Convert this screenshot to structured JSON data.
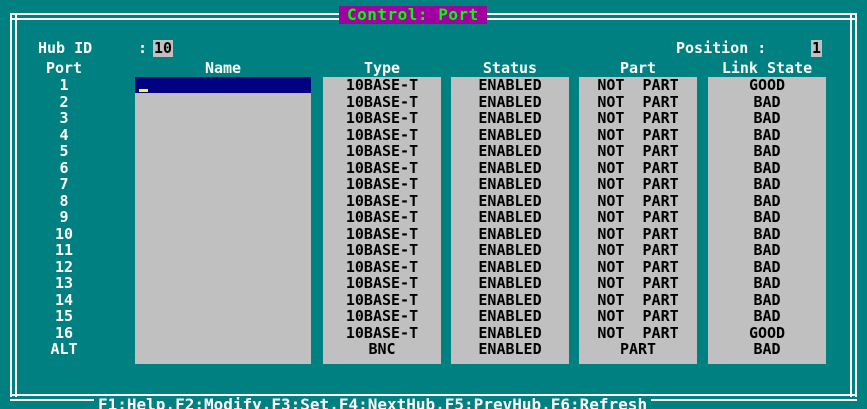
{
  "window": {
    "title": "Control: Port"
  },
  "hub": {
    "label": "Hub ID",
    "sep": ":",
    "id": "10"
  },
  "position": {
    "label": "Position :",
    "value": "1"
  },
  "headers": {
    "port": "Port",
    "name": "Name",
    "type": "Type",
    "status": "Status",
    "part": "Part",
    "link_state": "Link State"
  },
  "rows": [
    {
      "port": "1",
      "name": "",
      "type": "10BASE-T",
      "status": "ENABLED",
      "part": "NOT  PART",
      "link": "GOOD"
    },
    {
      "port": "2",
      "name": "",
      "type": "10BASE-T",
      "status": "ENABLED",
      "part": "NOT  PART",
      "link": "BAD"
    },
    {
      "port": "3",
      "name": "",
      "type": "10BASE-T",
      "status": "ENABLED",
      "part": "NOT  PART",
      "link": "BAD"
    },
    {
      "port": "4",
      "name": "",
      "type": "10BASE-T",
      "status": "ENABLED",
      "part": "NOT  PART",
      "link": "BAD"
    },
    {
      "port": "5",
      "name": "",
      "type": "10BASE-T",
      "status": "ENABLED",
      "part": "NOT  PART",
      "link": "BAD"
    },
    {
      "port": "6",
      "name": "",
      "type": "10BASE-T",
      "status": "ENABLED",
      "part": "NOT  PART",
      "link": "BAD"
    },
    {
      "port": "7",
      "name": "",
      "type": "10BASE-T",
      "status": "ENABLED",
      "part": "NOT  PART",
      "link": "BAD"
    },
    {
      "port": "8",
      "name": "",
      "type": "10BASE-T",
      "status": "ENABLED",
      "part": "NOT  PART",
      "link": "BAD"
    },
    {
      "port": "9",
      "name": "",
      "type": "10BASE-T",
      "status": "ENABLED",
      "part": "NOT  PART",
      "link": "BAD"
    },
    {
      "port": "10",
      "name": "",
      "type": "10BASE-T",
      "status": "ENABLED",
      "part": "NOT  PART",
      "link": "BAD"
    },
    {
      "port": "11",
      "name": "",
      "type": "10BASE-T",
      "status": "ENABLED",
      "part": "NOT  PART",
      "link": "BAD"
    },
    {
      "port": "12",
      "name": "",
      "type": "10BASE-T",
      "status": "ENABLED",
      "part": "NOT  PART",
      "link": "BAD"
    },
    {
      "port": "13",
      "name": "",
      "type": "10BASE-T",
      "status": "ENABLED",
      "part": "NOT  PART",
      "link": "BAD"
    },
    {
      "port": "14",
      "name": "",
      "type": "10BASE-T",
      "status": "ENABLED",
      "part": "NOT  PART",
      "link": "BAD"
    },
    {
      "port": "15",
      "name": "",
      "type": "10BASE-T",
      "status": "ENABLED",
      "part": "NOT  PART",
      "link": "BAD"
    },
    {
      "port": "16",
      "name": "",
      "type": "10BASE-T",
      "status": "ENABLED",
      "part": "NOT  PART",
      "link": "GOOD"
    },
    {
      "port": "ALT",
      "name": "",
      "type": "BNC",
      "status": "ENABLED",
      "part": "PART",
      "link": "BAD"
    }
  ],
  "footer": {
    "keys": "F1:Help,F2:Modify,F3:Set,F4:NextHub,F5:PrevHub,F6:Refresh"
  },
  "colors": {
    "background": "#008080",
    "title_bg": "#a000a0",
    "title_fg": "#00ff00",
    "field_bg": "#c0c0c0",
    "selection": "#000080",
    "cursor": "#ffff00"
  }
}
